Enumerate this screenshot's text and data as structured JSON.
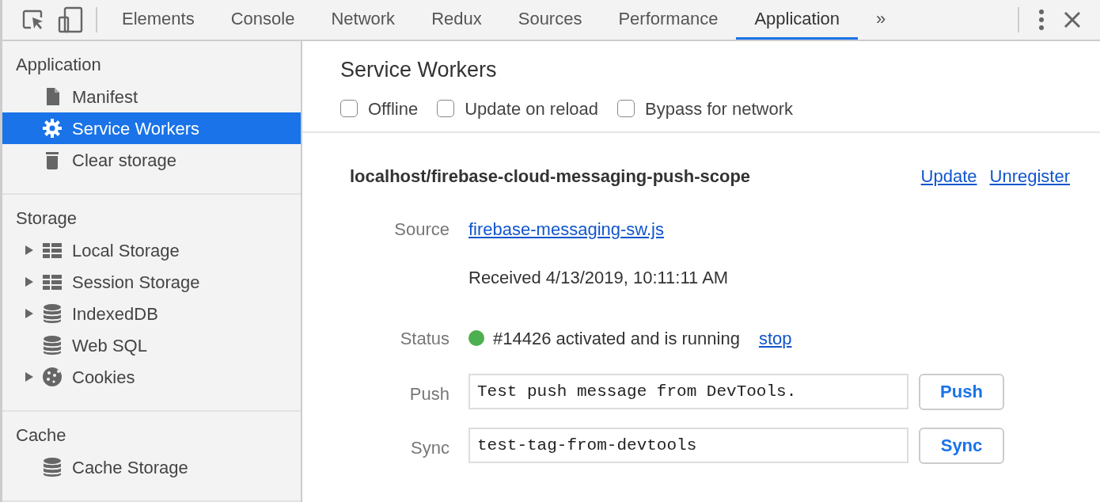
{
  "toolbar": {
    "tabs": [
      {
        "label": "Elements",
        "selected": false
      },
      {
        "label": "Console",
        "selected": false
      },
      {
        "label": "Network",
        "selected": false
      },
      {
        "label": "Redux",
        "selected": false
      },
      {
        "label": "Sources",
        "selected": false
      },
      {
        "label": "Performance",
        "selected": false
      },
      {
        "label": "Application",
        "selected": true
      }
    ],
    "overflow": "»"
  },
  "sidebar": {
    "sections": [
      {
        "title": "Application",
        "items": [
          {
            "label": "Manifest",
            "kind": "file",
            "expandable": false,
            "selected": false
          },
          {
            "label": "Service Workers",
            "kind": "gear",
            "expandable": false,
            "selected": true
          },
          {
            "label": "Clear storage",
            "kind": "trash",
            "expandable": false,
            "selected": false
          }
        ]
      },
      {
        "title": "Storage",
        "items": [
          {
            "label": "Local Storage",
            "kind": "grid",
            "expandable": true,
            "selected": false
          },
          {
            "label": "Session Storage",
            "kind": "grid",
            "expandable": true,
            "selected": false
          },
          {
            "label": "IndexedDB",
            "kind": "database",
            "expandable": true,
            "selected": false
          },
          {
            "label": "Web SQL",
            "kind": "database",
            "expandable": false,
            "selected": false
          },
          {
            "label": "Cookies",
            "kind": "cookie",
            "expandable": true,
            "selected": false
          }
        ]
      },
      {
        "title": "Cache",
        "items": [
          {
            "label": "Cache Storage",
            "kind": "database",
            "expandable": false,
            "selected": false
          }
        ]
      }
    ]
  },
  "main": {
    "title": "Service Workers",
    "options": [
      {
        "label": "Offline",
        "checked": false
      },
      {
        "label": "Update on reload",
        "checked": false
      },
      {
        "label": "Bypass for network",
        "checked": false
      }
    ],
    "worker": {
      "scope": "localhost/firebase-cloud-messaging-push-scope",
      "actions": [
        "Update",
        "Unregister"
      ],
      "source_label": "Source",
      "source_link": "firebase-messaging-sw.js",
      "received": "Received 4/13/2019, 10:11:11 AM",
      "status_label": "Status",
      "status_text": "#14426 activated and is running",
      "stop_link": "stop",
      "push": {
        "label": "Push",
        "value": "Test push message from DevTools.",
        "button": "Push"
      },
      "sync": {
        "label": "Sync",
        "value": "test-tag-from-devtools",
        "button": "Sync"
      }
    }
  }
}
